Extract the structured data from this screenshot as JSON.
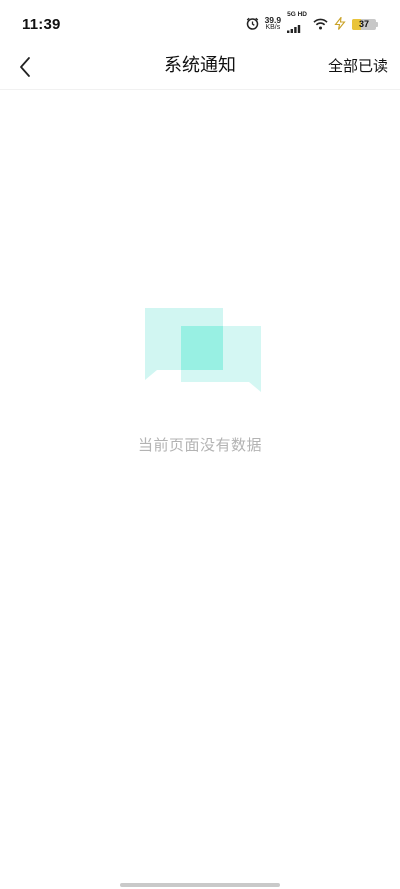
{
  "status_bar": {
    "time": "11:39",
    "net_speed_value": "39.9",
    "net_speed_unit": "KB/s",
    "network_type": "5G HD",
    "battery_level": "37",
    "icons": [
      "alarm-icon",
      "signal-icon",
      "wifi-icon",
      "charging-icon",
      "battery-icon"
    ]
  },
  "header": {
    "back_icon": "chevron-left-icon",
    "title": "系统通知",
    "mark_all_read": "全部已读"
  },
  "empty_state": {
    "icon": "chat-bubbles-icon",
    "message": "当前页面没有数据"
  },
  "colors": {
    "accent_light": "#c9f5f0",
    "accent_mid": "#98f0e3",
    "empty_text": "#b3b3b3",
    "battery_fill": "#e9c43a"
  }
}
